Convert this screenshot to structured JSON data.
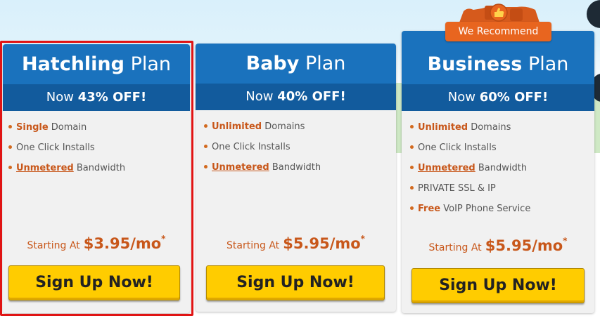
{
  "plans": [
    {
      "name_strong": "Hatchling",
      "name_light": "Plan",
      "discount_prefix": "Now",
      "discount": "43% OFF!",
      "features": [
        {
          "highlight": "Single",
          "rest": "Domain",
          "style": "hl"
        },
        {
          "highlight": "",
          "rest": "One Click Installs",
          "style": "none"
        },
        {
          "highlight": "Unmetered",
          "rest": "Bandwidth",
          "style": "hl-u"
        }
      ],
      "starting_label": "Starting At",
      "price": "$3.95/mo",
      "price_mark": "*",
      "cta": "Sign Up Now!"
    },
    {
      "name_strong": "Baby",
      "name_light": "Plan",
      "discount_prefix": "Now",
      "discount": "40% OFF!",
      "features": [
        {
          "highlight": "Unlimited",
          "rest": "Domains",
          "style": "hl"
        },
        {
          "highlight": "",
          "rest": "One Click Installs",
          "style": "none"
        },
        {
          "highlight": "Unmetered",
          "rest": "Bandwidth",
          "style": "hl-u"
        }
      ],
      "starting_label": "Starting At",
      "price": "$5.95/mo",
      "price_mark": "*",
      "cta": "Sign Up Now!"
    },
    {
      "name_strong": "Business",
      "name_light": "Plan",
      "discount_prefix": "Now",
      "discount": "60% OFF!",
      "features": [
        {
          "highlight": "Unlimited",
          "rest": "Domains",
          "style": "hl"
        },
        {
          "highlight": "",
          "rest": "One Click Installs",
          "style": "none"
        },
        {
          "highlight": "Unmetered",
          "rest": "Bandwidth",
          "style": "hl-u"
        },
        {
          "highlight": "",
          "rest": "PRIVATE SSL & IP",
          "style": "none"
        },
        {
          "highlight": "Free",
          "rest": "VoIP Phone Service",
          "style": "hl"
        }
      ],
      "starting_label": "Starting At",
      "price": "$5.95/mo",
      "price_mark": "*",
      "cta": "Sign Up Now!"
    }
  ],
  "badge": {
    "label": "We Recommend"
  },
  "colors": {
    "header_blue": "#1a72bd",
    "subheader_blue": "#125b9d",
    "accent_orange": "#c8571a",
    "button_yellow": "#ffcc00",
    "selected_frame": "#e01414",
    "badge_orange": "#e8651f"
  },
  "icons": [
    "thumbs-up-icon"
  ]
}
